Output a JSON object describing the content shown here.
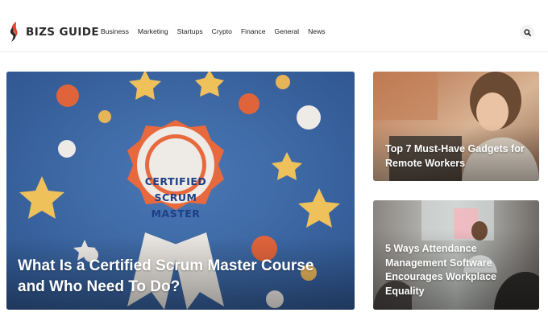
{
  "site": {
    "name": "BIZS GUIDE",
    "logo_color": "#e0472e"
  },
  "nav": {
    "items": [
      "Business",
      "Marketing",
      "Startups",
      "Crypto",
      "Finance",
      "General",
      "News"
    ]
  },
  "header": {
    "search_icon": "search-icon"
  },
  "featured": {
    "main": {
      "title": "What Is a Certified Scrum Master Course and Who Need To Do?",
      "badge_lines": [
        "CERTIFIED",
        "SCRUM",
        "MASTER"
      ]
    },
    "side": [
      {
        "title": "Top 7 Must-Have Gadgets for Remote Workers"
      },
      {
        "title": "5 Ways Attendance Management Software Encourages Workplace Equality"
      }
    ]
  }
}
